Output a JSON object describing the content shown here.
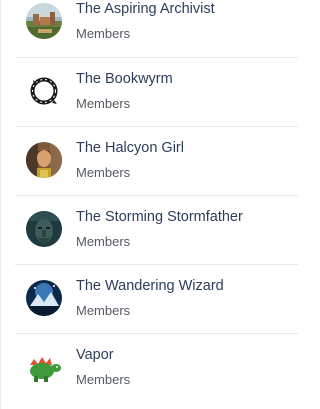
{
  "members": [
    {
      "name": "The Aspiring Archivist",
      "role": "Members",
      "avatar_icon": "castle-landscape-avatar"
    },
    {
      "name": "The Bookwyrm",
      "role": "Members",
      "avatar_icon": "ouroboros-avatar"
    },
    {
      "name": "The Halcyon Girl",
      "role": "Members",
      "avatar_icon": "portrait-painting-avatar"
    },
    {
      "name": "The Storming Stormfather",
      "role": "Members",
      "avatar_icon": "stone-face-avatar"
    },
    {
      "name": "The Wandering Wizard",
      "role": "Members",
      "avatar_icon": "fantasy-scene-avatar"
    },
    {
      "name": "Vapor",
      "role": "Members",
      "avatar_icon": "green-dinosaur-avatar"
    }
  ],
  "colors": {
    "name_text": "#2c3e5a",
    "role_text": "#555b63",
    "divider": "#e8e8e8"
  }
}
